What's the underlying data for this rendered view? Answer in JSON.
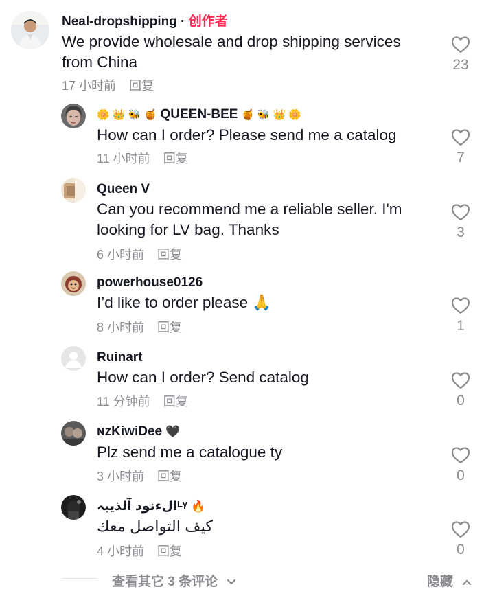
{
  "main_comment": {
    "username": "Neal-dropshipping",
    "separator": "·",
    "creator_tag": "创作者",
    "text": "We provide wholesale and drop shipping services from China",
    "time": "17 小时前",
    "reply_label": "回复",
    "likes": "23"
  },
  "replies": [
    {
      "username": "QUEEN-BEE",
      "decor_left": "🌼 👑 🐝 🍯",
      "decor_right": "🍯 🐝 👑 🌼",
      "text": "How can I order? Please send me a catalog",
      "time": "11 小时前",
      "reply_label": "回复",
      "likes": "7"
    },
    {
      "username": "Queen V",
      "text": "Can you recommend me a reliable seller. I'm looking for LV bag. Thanks",
      "time": "6 小时前",
      "reply_label": "回复",
      "likes": "3"
    },
    {
      "username": "powerhouse0126",
      "text": "I’d like to order please",
      "text_emoji": "🙏",
      "time": "8 小时前",
      "reply_label": "回复",
      "likes": "1"
    },
    {
      "username": "Ruinart",
      "text": "How can I order? Send catalog",
      "time": "11 分钟前",
      "reply_label": "回复",
      "likes": "0"
    },
    {
      "username": "ɴᴢKiwiDee",
      "username_emoji": "🖤",
      "text": "Plz send me a catalogue ty",
      "time": "3 小时前",
      "reply_label": "回复",
      "likes": "0"
    },
    {
      "username": "الءنود آلذيبہᴸᵞ",
      "username_emoji": "🔥",
      "text": "كيف التواصل معك",
      "time": "4 小时前",
      "reply_label": "回复",
      "likes": "0"
    }
  ],
  "footer": {
    "view_more": "查看其它 3 条评论",
    "hide": "隐藏"
  },
  "icons": {
    "like": "heart-outline-icon",
    "view_more": "chevron-down-icon",
    "hide": "chevron-up-icon"
  },
  "colors": {
    "creator_tag": "#fe2c55",
    "meta": "#8a8b91",
    "text": "#161823"
  }
}
